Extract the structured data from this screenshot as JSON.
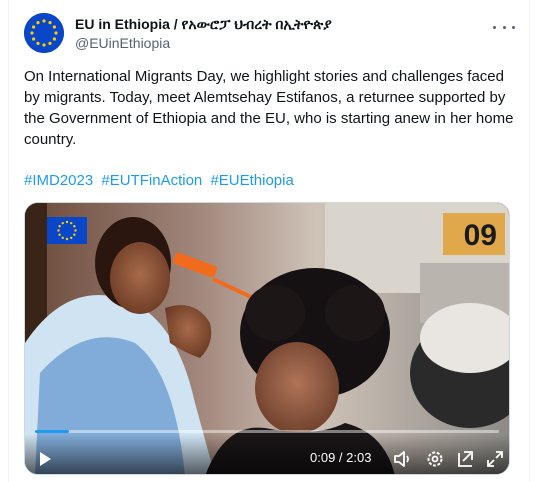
{
  "author": {
    "display_name": "EU in Ethiopia / የአውሮፓ ህብረት በኢትዮጵያ",
    "handle": "@EUinEthiopia",
    "avatar_icon": "eu-flag-icon",
    "more_icon": "more-options-icon"
  },
  "tweet": {
    "text": "On International Migrants Day, we highlight stories and challenges faced by migrants. Today, meet Alemtsehay Estifanos, a returnee supported by the Government of Ethiopia and the EU, who is starting anew in her home country.",
    "hashtags": [
      "#IMD2023",
      "#EUTFinAction",
      "#EUEthiopia"
    ]
  },
  "video": {
    "overlay_logo_icon": "eu-flag-icon",
    "background_sign": "09",
    "current_time": "0:09",
    "duration": "2:03",
    "time_label": "0:09 / 2:03",
    "progress": 0.073,
    "controls": {
      "play_icon": "play-icon",
      "volume_icon": "volume-icon",
      "settings_icon": "settings-icon",
      "pip_icon": "picture-in-picture-icon",
      "fullscreen_icon": "fullscreen-icon"
    }
  },
  "colors": {
    "link": "#1d9bf0",
    "text": "#0f1419",
    "secondary": "#536471",
    "eu_blue": "#0a46c8",
    "eu_star": "#ffcc00"
  }
}
